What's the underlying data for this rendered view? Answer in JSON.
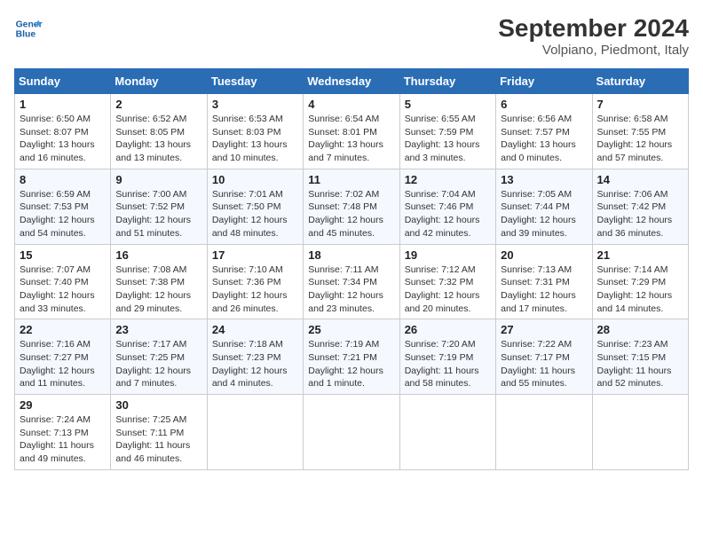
{
  "header": {
    "logo_line1": "General",
    "logo_line2": "Blue",
    "title": "September 2024",
    "subtitle": "Volpiano, Piedmont, Italy"
  },
  "days_of_week": [
    "Sunday",
    "Monday",
    "Tuesday",
    "Wednesday",
    "Thursday",
    "Friday",
    "Saturday"
  ],
  "weeks": [
    [
      {
        "day": "1",
        "lines": [
          "Sunrise: 6:50 AM",
          "Sunset: 8:07 PM",
          "Daylight: 13 hours",
          "and 16 minutes."
        ]
      },
      {
        "day": "2",
        "lines": [
          "Sunrise: 6:52 AM",
          "Sunset: 8:05 PM",
          "Daylight: 13 hours",
          "and 13 minutes."
        ]
      },
      {
        "day": "3",
        "lines": [
          "Sunrise: 6:53 AM",
          "Sunset: 8:03 PM",
          "Daylight: 13 hours",
          "and 10 minutes."
        ]
      },
      {
        "day": "4",
        "lines": [
          "Sunrise: 6:54 AM",
          "Sunset: 8:01 PM",
          "Daylight: 13 hours",
          "and 7 minutes."
        ]
      },
      {
        "day": "5",
        "lines": [
          "Sunrise: 6:55 AM",
          "Sunset: 7:59 PM",
          "Daylight: 13 hours",
          "and 3 minutes."
        ]
      },
      {
        "day": "6",
        "lines": [
          "Sunrise: 6:56 AM",
          "Sunset: 7:57 PM",
          "Daylight: 13 hours",
          "and 0 minutes."
        ]
      },
      {
        "day": "7",
        "lines": [
          "Sunrise: 6:58 AM",
          "Sunset: 7:55 PM",
          "Daylight: 12 hours",
          "and 57 minutes."
        ]
      }
    ],
    [
      {
        "day": "8",
        "lines": [
          "Sunrise: 6:59 AM",
          "Sunset: 7:53 PM",
          "Daylight: 12 hours",
          "and 54 minutes."
        ]
      },
      {
        "day": "9",
        "lines": [
          "Sunrise: 7:00 AM",
          "Sunset: 7:52 PM",
          "Daylight: 12 hours",
          "and 51 minutes."
        ]
      },
      {
        "day": "10",
        "lines": [
          "Sunrise: 7:01 AM",
          "Sunset: 7:50 PM",
          "Daylight: 12 hours",
          "and 48 minutes."
        ]
      },
      {
        "day": "11",
        "lines": [
          "Sunrise: 7:02 AM",
          "Sunset: 7:48 PM",
          "Daylight: 12 hours",
          "and 45 minutes."
        ]
      },
      {
        "day": "12",
        "lines": [
          "Sunrise: 7:04 AM",
          "Sunset: 7:46 PM",
          "Daylight: 12 hours",
          "and 42 minutes."
        ]
      },
      {
        "day": "13",
        "lines": [
          "Sunrise: 7:05 AM",
          "Sunset: 7:44 PM",
          "Daylight: 12 hours",
          "and 39 minutes."
        ]
      },
      {
        "day": "14",
        "lines": [
          "Sunrise: 7:06 AM",
          "Sunset: 7:42 PM",
          "Daylight: 12 hours",
          "and 36 minutes."
        ]
      }
    ],
    [
      {
        "day": "15",
        "lines": [
          "Sunrise: 7:07 AM",
          "Sunset: 7:40 PM",
          "Daylight: 12 hours",
          "and 33 minutes."
        ]
      },
      {
        "day": "16",
        "lines": [
          "Sunrise: 7:08 AM",
          "Sunset: 7:38 PM",
          "Daylight: 12 hours",
          "and 29 minutes."
        ]
      },
      {
        "day": "17",
        "lines": [
          "Sunrise: 7:10 AM",
          "Sunset: 7:36 PM",
          "Daylight: 12 hours",
          "and 26 minutes."
        ]
      },
      {
        "day": "18",
        "lines": [
          "Sunrise: 7:11 AM",
          "Sunset: 7:34 PM",
          "Daylight: 12 hours",
          "and 23 minutes."
        ]
      },
      {
        "day": "19",
        "lines": [
          "Sunrise: 7:12 AM",
          "Sunset: 7:32 PM",
          "Daylight: 12 hours",
          "and 20 minutes."
        ]
      },
      {
        "day": "20",
        "lines": [
          "Sunrise: 7:13 AM",
          "Sunset: 7:31 PM",
          "Daylight: 12 hours",
          "and 17 minutes."
        ]
      },
      {
        "day": "21",
        "lines": [
          "Sunrise: 7:14 AM",
          "Sunset: 7:29 PM",
          "Daylight: 12 hours",
          "and 14 minutes."
        ]
      }
    ],
    [
      {
        "day": "22",
        "lines": [
          "Sunrise: 7:16 AM",
          "Sunset: 7:27 PM",
          "Daylight: 12 hours",
          "and 11 minutes."
        ]
      },
      {
        "day": "23",
        "lines": [
          "Sunrise: 7:17 AM",
          "Sunset: 7:25 PM",
          "Daylight: 12 hours",
          "and 7 minutes."
        ]
      },
      {
        "day": "24",
        "lines": [
          "Sunrise: 7:18 AM",
          "Sunset: 7:23 PM",
          "Daylight: 12 hours",
          "and 4 minutes."
        ]
      },
      {
        "day": "25",
        "lines": [
          "Sunrise: 7:19 AM",
          "Sunset: 7:21 PM",
          "Daylight: 12 hours",
          "and 1 minute."
        ]
      },
      {
        "day": "26",
        "lines": [
          "Sunrise: 7:20 AM",
          "Sunset: 7:19 PM",
          "Daylight: 11 hours",
          "and 58 minutes."
        ]
      },
      {
        "day": "27",
        "lines": [
          "Sunrise: 7:22 AM",
          "Sunset: 7:17 PM",
          "Daylight: 11 hours",
          "and 55 minutes."
        ]
      },
      {
        "day": "28",
        "lines": [
          "Sunrise: 7:23 AM",
          "Sunset: 7:15 PM",
          "Daylight: 11 hours",
          "and 52 minutes."
        ]
      }
    ],
    [
      {
        "day": "29",
        "lines": [
          "Sunrise: 7:24 AM",
          "Sunset: 7:13 PM",
          "Daylight: 11 hours",
          "and 49 minutes."
        ]
      },
      {
        "day": "30",
        "lines": [
          "Sunrise: 7:25 AM",
          "Sunset: 7:11 PM",
          "Daylight: 11 hours",
          "and 46 minutes."
        ]
      },
      {
        "day": "",
        "lines": []
      },
      {
        "day": "",
        "lines": []
      },
      {
        "day": "",
        "lines": []
      },
      {
        "day": "",
        "lines": []
      },
      {
        "day": "",
        "lines": []
      }
    ]
  ]
}
